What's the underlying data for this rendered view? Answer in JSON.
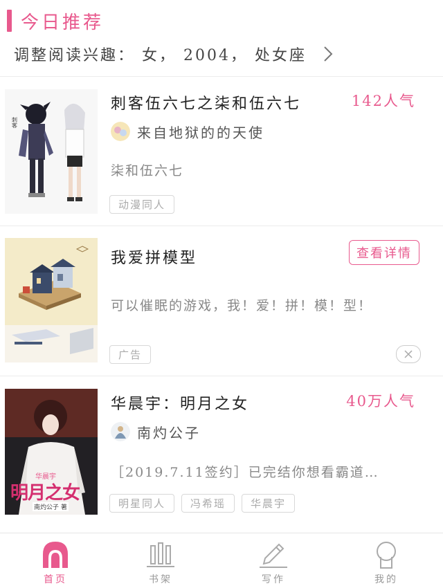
{
  "header": {
    "section_title": "今日推荐",
    "prefs_text": "调整阅读兴趣： 女， 2004， 处女座"
  },
  "cards": [
    {
      "title": "刺客伍六七之柒和伍六七",
      "popularity": "142人气",
      "author": "来自地狱的的天使",
      "description": "柒和伍六七",
      "tags": [
        "动漫同人"
      ]
    },
    {
      "title": "我爱拼模型",
      "button_label": "查看详情",
      "description": "可以催眠的游戏，我！爱！拼！模！型！",
      "tags": [
        "广告"
      ],
      "close_icon": "close-icon"
    },
    {
      "title": "华晨宇：明月之女",
      "popularity": "40万人气",
      "author": "南灼公子",
      "description": "［2019.7.11签约］已完结你想看霸道…",
      "tags": [
        "明星同人",
        "冯希瑶",
        "华晨宇"
      ],
      "cover_text_top": "华晨宇",
      "cover_text_main": "明月之女",
      "cover_text_author": "南灼公子 著"
    }
  ],
  "tabbar": {
    "items": [
      {
        "label": "首页",
        "icon": "home-icon",
        "active": true
      },
      {
        "label": "书架",
        "icon": "bookshelf-icon",
        "active": false
      },
      {
        "label": "写作",
        "icon": "pen-icon",
        "active": false
      },
      {
        "label": "我的",
        "icon": "profile-icon",
        "active": false
      }
    ]
  },
  "colors": {
    "accent": "#e8598d",
    "text": "#222222",
    "muted": "#888888"
  }
}
